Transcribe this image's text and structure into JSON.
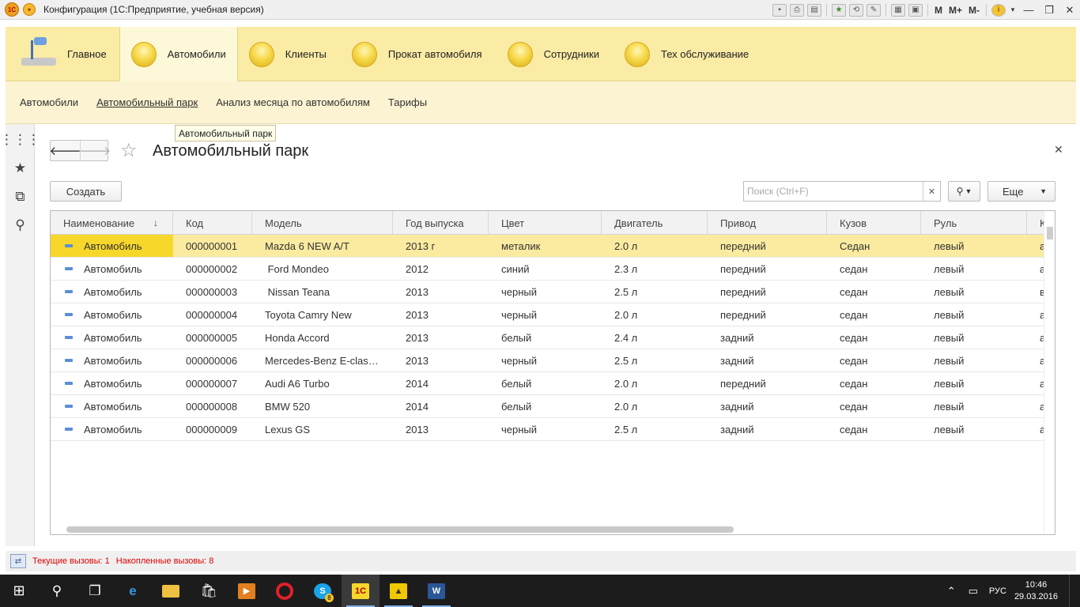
{
  "window": {
    "title": "Конфигурация  (1С:Предприятие, учебная версия)",
    "app_logo": "1C",
    "toolbar_text": [
      "M",
      "M+",
      "M-"
    ]
  },
  "sections": [
    {
      "label": "Главное",
      "icon": "desk-lamp-icon"
    },
    {
      "label": "Автомобили",
      "icon": "yellow-circle-icon",
      "active": true
    },
    {
      "label": "Клиенты",
      "icon": "yellow-circle-icon"
    },
    {
      "label": "Прокат автомобиля",
      "icon": "yellow-circle-icon"
    },
    {
      "label": "Сотрудники",
      "icon": "yellow-circle-icon"
    },
    {
      "label": "Тех обслуживание",
      "icon": "yellow-circle-icon"
    }
  ],
  "functions": [
    {
      "label": "Автомобили"
    },
    {
      "label": "Автомобильный парк",
      "active": true
    },
    {
      "label": "Анализ месяца по автомобилям"
    },
    {
      "label": "Тарифы"
    }
  ],
  "tooltip": "Автомобильный парк",
  "form": {
    "title": "Автомобильный парк",
    "create_label": "Создать",
    "search_placeholder": "Поиск (Ctrl+F)",
    "more_label": "Еще"
  },
  "table": {
    "columns": [
      "Наименование",
      "Код",
      "Модель",
      "Год выпуска",
      "Цвет",
      "Двигатель",
      "Привод",
      "Кузов",
      "Руль",
      "К"
    ],
    "sort_indicator": "↓",
    "rows": [
      {
        "name": "Автомобиль",
        "code": "000000001",
        "model": "Mazda 6 NEW A/T",
        "year": "2013 г",
        "color": "металик",
        "engine": "2.0 л",
        "drive": "передний",
        "body": "Седан",
        "wheel": "левый",
        "extra": "а"
      },
      {
        "name": "Автомобиль",
        "code": "000000002",
        "model": " Ford Mondeo",
        "year": "2012",
        "color": "синий",
        "engine": "2.3 л",
        "drive": "передний",
        "body": "седан",
        "wheel": "левый",
        "extra": "а"
      },
      {
        "name": "Автомобиль",
        "code": "000000003",
        "model": " Nissan Teana",
        "year": "2013",
        "color": "черный",
        "engine": "2.5 л",
        "drive": "передний",
        "body": "седан",
        "wheel": "левый",
        "extra": "в"
      },
      {
        "name": "Автомобиль",
        "code": "000000004",
        "model": "Toyota Camry New",
        "year": "2013",
        "color": "черный",
        "engine": "2.0 л",
        "drive": "передний",
        "body": "седан",
        "wheel": "левый",
        "extra": "а"
      },
      {
        "name": "Автомобиль",
        "code": "000000005",
        "model": "Honda Accord",
        "year": "2013",
        "color": "белый",
        "engine": "2.4 л",
        "drive": "задний",
        "body": "седан",
        "wheel": "левый",
        "extra": "а"
      },
      {
        "name": "Автомобиль",
        "code": "000000006",
        "model": "Mercedes-Benz E-clas…",
        "year": "2013",
        "color": "черный",
        "engine": "2.5 л",
        "drive": "задний",
        "body": "седан",
        "wheel": "левый",
        "extra": "а"
      },
      {
        "name": "Автомобиль",
        "code": "000000007",
        "model": "Audi A6 Turbo",
        "year": "2014",
        "color": "белый",
        "engine": "2.0 л",
        "drive": "передний",
        "body": "седан",
        "wheel": "левый",
        "extra": "а"
      },
      {
        "name": "Автомобиль",
        "code": "000000008",
        "model": "BMW 520",
        "year": "2014",
        "color": "белый",
        "engine": "2.0 л",
        "drive": "задний",
        "body": "седан",
        "wheel": "левый",
        "extra": "а"
      },
      {
        "name": "Автомобиль",
        "code": "000000009",
        "model": "Lexus GS",
        "year": "2013",
        "color": "черный",
        "engine": "2.5 л",
        "drive": "задний",
        "body": "седан",
        "wheel": "левый",
        "extra": "а"
      }
    ]
  },
  "status": {
    "current_calls": "Текущие вызовы: 1",
    "accumulated_calls": "Накопленные вызовы: 8"
  },
  "taskbar": {
    "language": "РУС",
    "time": "10:46",
    "date": "29.03.2016",
    "skype_badge": "8"
  }
}
